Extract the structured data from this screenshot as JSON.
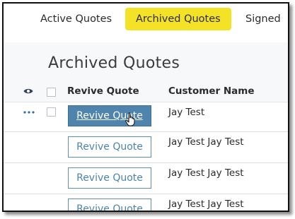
{
  "tabs": [
    {
      "label": "Active Quotes",
      "active": false
    },
    {
      "label": "Archived Quotes",
      "active": true
    },
    {
      "label": "Signed",
      "active": false
    }
  ],
  "panel": {
    "title": "Archived Quotes"
  },
  "table": {
    "columns": [
      "Revive Quote",
      "Customer Name"
    ],
    "rows": [
      {
        "action_label": "Revive Quote",
        "customer": "Jay Test"
      },
      {
        "action_label": "Revive Quote",
        "customer": "Jay Test Jay Test"
      },
      {
        "action_label": "Revive Quote",
        "customer": "Jay Test Jay Test"
      },
      {
        "action_label": "Revive Quote",
        "customer": "Jay Test Jay Test"
      }
    ]
  },
  "colors": {
    "active_tab": "#f4e227",
    "button_accent": "#4f84ad",
    "row_menu_dots": "#2f6fa5"
  },
  "icons": {
    "header_visibility": "eye-icon",
    "row_menu": "more-dots-icon",
    "pointer": "hand-pointer-cursor"
  }
}
